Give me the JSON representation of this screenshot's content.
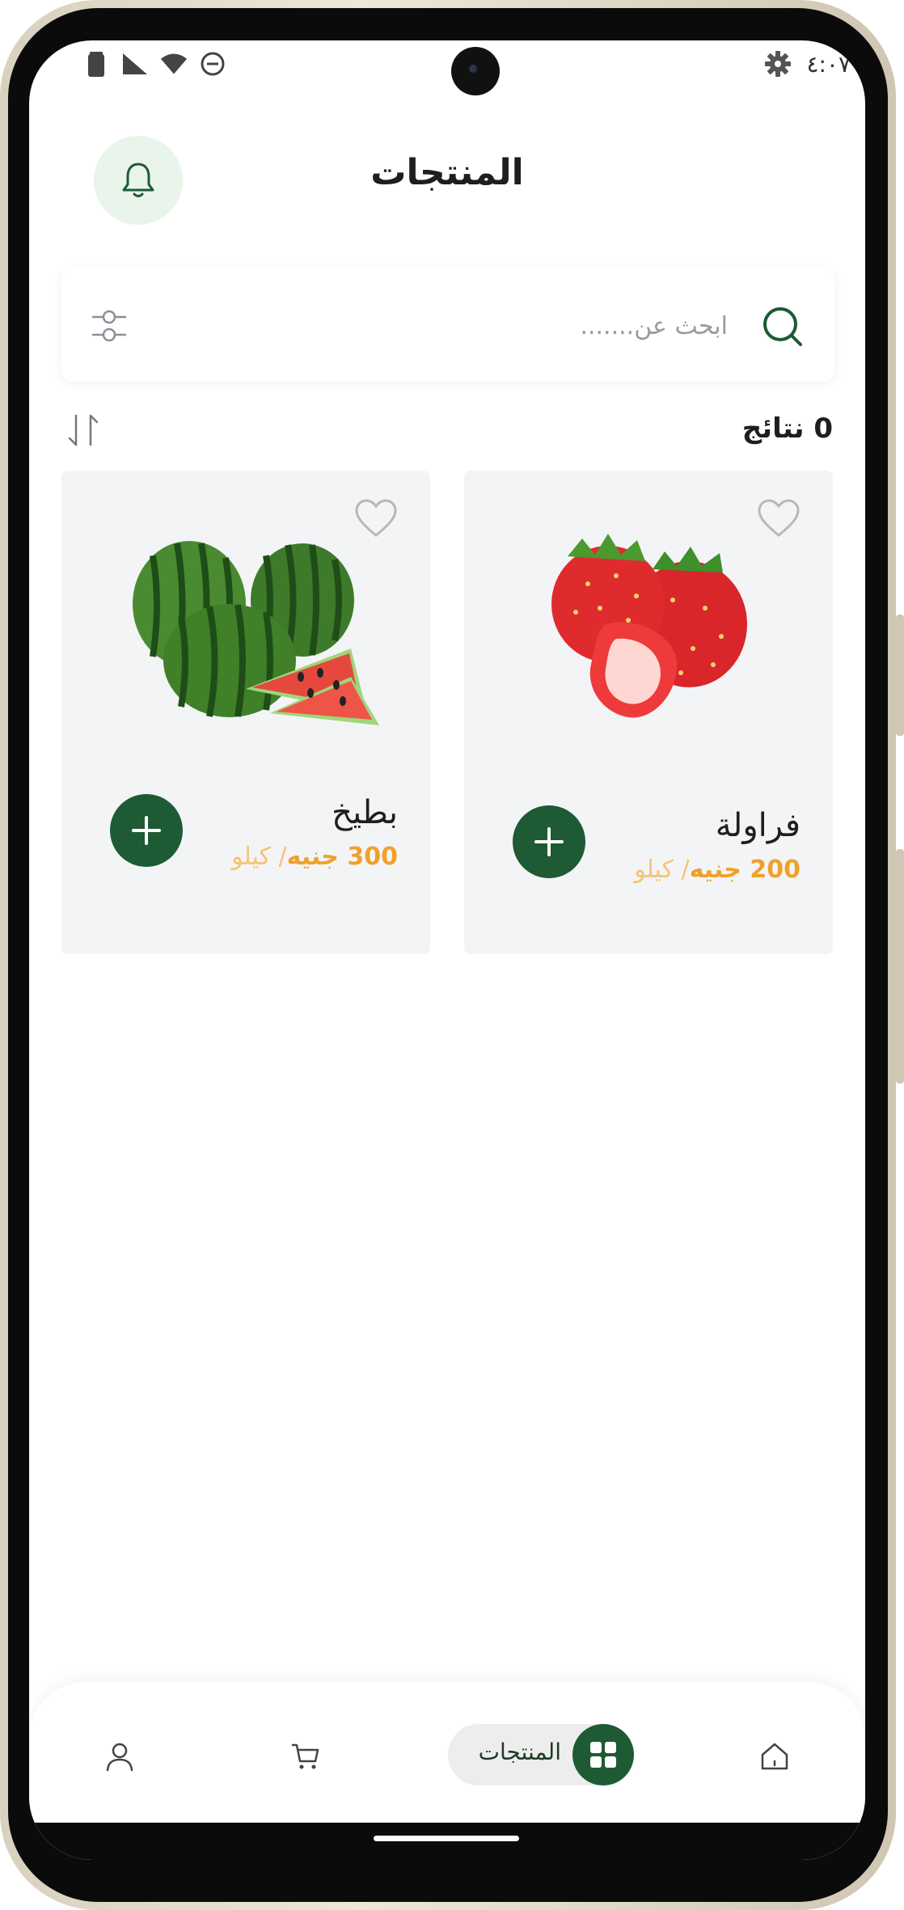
{
  "status_bar": {
    "time": "٤:٠٧"
  },
  "header": {
    "title": "المنتجات"
  },
  "search": {
    "placeholder": "ابحث عن......."
  },
  "results": {
    "count_label": "0 نتائج"
  },
  "products": [
    {
      "name": "فراولة",
      "price": "200 جنيه",
      "unit": "/ كيلو",
      "image": "strawberry-image"
    },
    {
      "name": "بطيخ",
      "price": "300 جنيه",
      "unit": "/ كيلو",
      "image": "watermelon-image"
    }
  ],
  "bottom_nav": {
    "active_label": "المنتجات"
  },
  "colors": {
    "primary": "#1e5a34",
    "price": "#f0a12a",
    "card_bg": "#f3f4f6",
    "bell_bg": "#e9f4ea"
  }
}
